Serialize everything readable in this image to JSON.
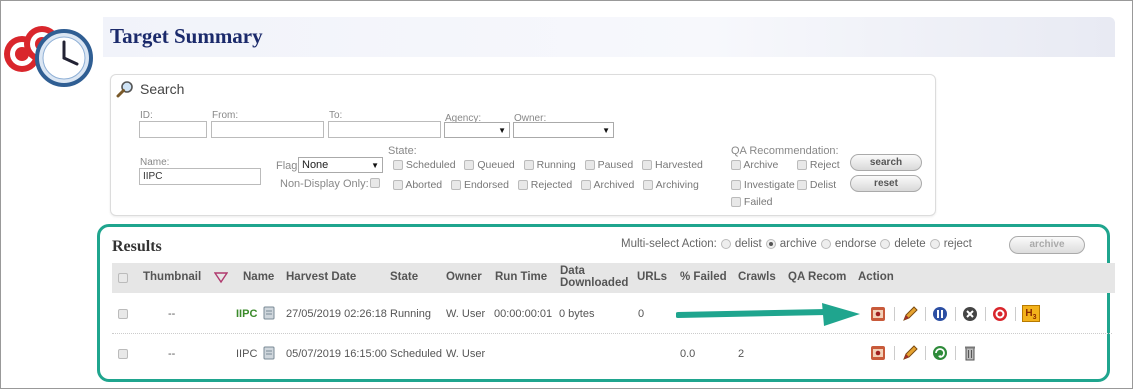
{
  "page_title": "Target Summary",
  "search": {
    "title": "Search",
    "labels": {
      "id": "ID:",
      "from": "From:",
      "to": "To:",
      "agency": "Agency:",
      "owner": "Owner:",
      "name": "Name:",
      "flag": "Flag:",
      "non_display": "Non-Display Only:",
      "state": "State:",
      "qa": "QA Recommendation:"
    },
    "name_value": "IIPC",
    "flag_value": "None",
    "states_row1": [
      "Scheduled",
      "Queued",
      "Running",
      "Paused",
      "Harvested"
    ],
    "states_row2": [
      "Aborted",
      "Endorsed",
      "Rejected",
      "Archived",
      "Archiving"
    ],
    "qa_options": [
      "Archive",
      "Reject",
      "Investigate",
      "Delist",
      "Failed"
    ],
    "search_button": "search",
    "reset_button": "reset"
  },
  "results": {
    "title": "Results",
    "multi_label": "Multi-select Action:",
    "multi_options": [
      "delist",
      "archive",
      "endorse",
      "delete",
      "reject"
    ],
    "multi_selected": "archive",
    "archive_button": "archive",
    "columns": [
      "Thumbnail",
      "Name",
      "Harvest Date",
      "State",
      "Owner",
      "Run Time",
      "Data Downloaded",
      "URLs",
      "% Failed",
      "Crawls",
      "QA Recom",
      "Action"
    ],
    "rows": [
      {
        "thumbnail": "--",
        "name": "IIPC",
        "harvest_date": "27/05/2019 02:26:18",
        "state": "Running",
        "owner": "W. User",
        "run_time": "00:00:00:01",
        "data": "0 bytes",
        "urls": "0",
        "failed": "",
        "crawls": "",
        "qa": ""
      },
      {
        "thumbnail": "--",
        "name": "IIPC",
        "harvest_date": "05/07/2019 16:15:00",
        "state": "Scheduled",
        "owner": "W. User",
        "run_time": "",
        "data": "",
        "urls": "",
        "failed": "0.0",
        "crawls": "2",
        "qa": ""
      }
    ]
  },
  "colors": {
    "accent": "#1fa58e",
    "title": "#1b2a6b",
    "name_green": "#3a8a2a"
  }
}
